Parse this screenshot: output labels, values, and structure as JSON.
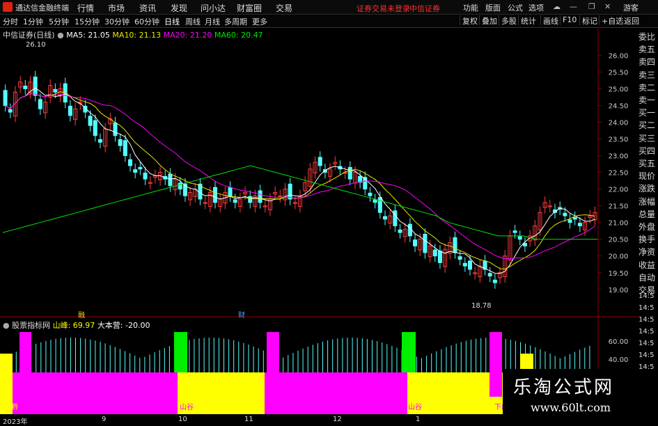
{
  "app": {
    "title": "通达信金融终端",
    "menu": [
      "行情",
      "市场",
      "资讯",
      "发现",
      "问小达",
      "财富圈",
      "交易"
    ],
    "warning": "证券交易未登录",
    "warning2": "中信证券",
    "right_menu": [
      "功能",
      "版面",
      "公式",
      "选项"
    ],
    "guest": "游客"
  },
  "toolbar": {
    "periods": [
      "分时",
      "1分钟",
      "5分钟",
      "15分钟",
      "30分钟",
      "60分钟",
      "日线",
      "周线",
      "月线",
      "多周期",
      "更多"
    ],
    "active_period": "日线",
    "right": [
      "复权",
      "叠加",
      "多股",
      "统计",
      "画线",
      "F10",
      "标记",
      "+自选",
      "返回"
    ]
  },
  "stock": {
    "name": "中信证券(日线)",
    "ma5": "MA5: 21.05",
    "ma10": "MA10: 21.13",
    "ma20": "MA20: 21.20",
    "ma60": "MA60: 20.47",
    "high_mark": "26.10",
    "low_mark": "18.78",
    "event1": "融",
    "event2": "财"
  },
  "indicator": {
    "name": "股票指标网",
    "value1": "山峰: 69.97",
    "value2": "大本营: -20.00",
    "labels": [
      "小黔",
      "山谷",
      "下山",
      "山谷",
      "下山"
    ]
  },
  "side_panel": [
    "委比",
    "卖五",
    "卖四",
    "卖三",
    "卖二",
    "卖一",
    "买一",
    "买二",
    "买三",
    "买四",
    "买五",
    "现价",
    "涨跌",
    "涨幅",
    "总量",
    "外盘",
    "换手",
    "净资",
    "收益",
    "自动",
    "交易"
  ],
  "side_times": [
    "14:5",
    "14:5",
    "14:5",
    "14:5",
    "14:5",
    "14:5",
    "14:5"
  ],
  "x_labels": [
    "2023年",
    "9",
    "10",
    "11",
    "12",
    "1"
  ],
  "watermark": {
    "line1": "乐淘公式网",
    "line2": "www.60lt.com"
  },
  "colors": {
    "up": "#ff3c3c",
    "down": "#54ffff",
    "ma5": "#ffffff",
    "ma10": "#e6e600",
    "ma20": "#ff00ff",
    "ma60": "#00e600",
    "magenta": "#ff00ff",
    "yellow": "#ffff00",
    "green": "#00ee00"
  },
  "chart_data": {
    "type": "candlestick",
    "y_ticks": [
      26.0,
      25.5,
      25.0,
      24.5,
      24.0,
      23.5,
      23.0,
      22.5,
      22.0,
      21.5,
      21.0,
      20.5,
      20.0,
      19.5,
      19.0
    ],
    "ylim": [
      18.6,
      26.3
    ],
    "indicator_ticks": [
      60.0,
      40.0
    ],
    "close": [
      24.5,
      24.3,
      24.9,
      25.2,
      25.0,
      25.2,
      24.8,
      24.4,
      24.6,
      25.1,
      24.9,
      25.0,
      24.6,
      24.2,
      24.4,
      24.6,
      24.3,
      23.9,
      23.6,
      23.4,
      23.8,
      24.1,
      23.6,
      23.3,
      23.0,
      22.7,
      22.5,
      22.6,
      22.3,
      22.2,
      22.4,
      22.5,
      22.3,
      22.1,
      22.3,
      22.0,
      21.8,
      21.9,
      22.0,
      21.7,
      21.6,
      21.9,
      21.6,
      21.7,
      21.9,
      21.8,
      21.6,
      21.7,
      21.9,
      21.6,
      21.8,
      21.6,
      21.5,
      21.7,
      21.9,
      21.8,
      22.0,
      21.7,
      21.6,
      21.8,
      22.2,
      22.6,
      22.8,
      22.7,
      22.5,
      22.6,
      22.8,
      22.6,
      22.5,
      22.3,
      22.5,
      22.2,
      22.0,
      21.8,
      21.6,
      21.3,
      21.1,
      21.2,
      20.9,
      20.7,
      20.8,
      20.6,
      20.3,
      20.5,
      20.1,
      20.3,
      20.0,
      19.8,
      20.2,
      20.4,
      20.1,
      19.9,
      19.7,
      19.6,
      19.5,
      19.7,
      19.6,
      19.4,
      19.2,
      19.5,
      20.0,
      20.6,
      20.7,
      20.5,
      20.3,
      20.6,
      20.9,
      21.3,
      21.6,
      21.5,
      21.3,
      21.4,
      21.2,
      21.0,
      21.1,
      20.9,
      21.0,
      21.2,
      21.3
    ],
    "ma60": [
      20.7,
      20.8,
      20.9,
      21.0,
      21.1,
      21.2,
      21.3,
      21.4,
      21.5,
      21.6,
      21.7,
      21.8,
      21.9,
      22.0,
      22.1,
      22.2,
      22.3,
      22.4,
      22.5,
      22.6,
      22.7,
      22.6,
      22.5,
      22.4,
      22.3,
      22.2,
      22.1,
      22.0,
      21.9,
      21.8,
      21.7,
      21.6,
      21.5,
      21.4,
      21.3,
      21.2,
      21.0,
      20.9,
      20.8,
      20.7,
      20.6,
      20.6,
      20.6,
      20.5,
      20.5,
      20.5,
      20.5,
      20.5,
      20.5
    ]
  }
}
